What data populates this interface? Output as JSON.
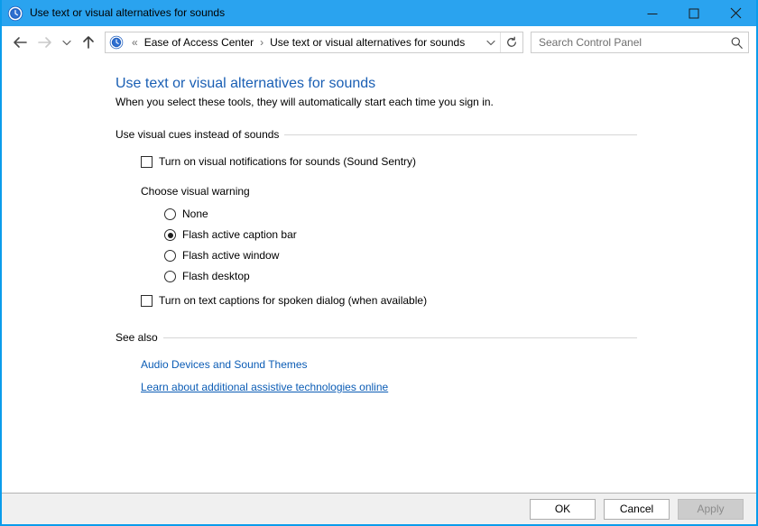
{
  "window": {
    "title": "Use text or visual alternatives for sounds",
    "title_icon": "ease-of-access-icon",
    "accent_color": "#2aa3ef",
    "controls": {
      "minimize": "minimize-icon",
      "maximize": "maximize-icon",
      "close": "close-icon"
    }
  },
  "navbar": {
    "back": "back-arrow-icon",
    "forward": "forward-arrow-icon",
    "recent": "chevron-down-icon",
    "up": "up-arrow-icon",
    "address": {
      "icon": "ease-of-access-icon",
      "overflow": "«",
      "crumbs": [
        {
          "label": "Ease of Access Center"
        },
        {
          "label": "Use text or visual alternatives for sounds"
        }
      ],
      "separator": "›",
      "dropdown": "chevron-down-icon",
      "refresh": "refresh-icon"
    },
    "search": {
      "value": "",
      "placeholder": "Search Control Panel",
      "icon": "search-icon"
    }
  },
  "main": {
    "title": "Use text or visual alternatives for sounds",
    "subtitle": "When you select these tools, they will automatically start each time you sign in.",
    "sections": [
      {
        "header": "Use visual cues instead of sounds",
        "sound_sentry": {
          "label": "Turn on visual notifications for sounds (Sound Sentry)",
          "checked": false
        },
        "warning_group_label": "Choose visual warning",
        "warning_options": [
          {
            "label": "None",
            "selected": false
          },
          {
            "label": "Flash active caption bar",
            "selected": true
          },
          {
            "label": "Flash active window",
            "selected": false
          },
          {
            "label": "Flash desktop",
            "selected": false
          }
        ],
        "captions": {
          "label": "Turn on text captions for spoken dialog (when available)",
          "checked": false
        }
      },
      {
        "header": "See also",
        "links": [
          {
            "label": "Audio Devices and Sound Themes",
            "underlined": false
          },
          {
            "label": "Learn about additional assistive technologies online",
            "underlined": true
          }
        ]
      }
    ]
  },
  "footer": {
    "ok": "OK",
    "cancel": "Cancel",
    "apply": "Apply",
    "apply_disabled": true
  }
}
